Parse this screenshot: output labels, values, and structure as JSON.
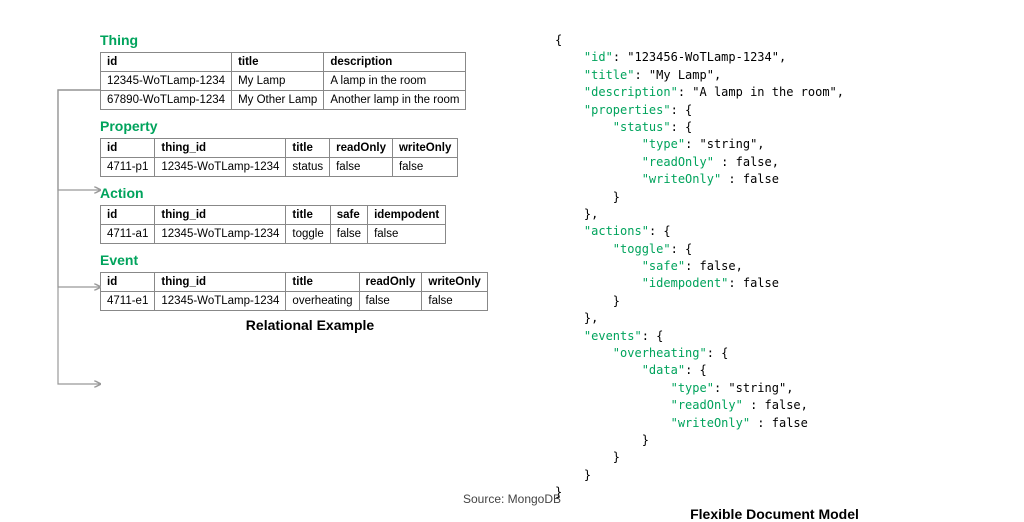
{
  "left": {
    "thing": {
      "title": "Thing",
      "headers": [
        "id",
        "title",
        "description"
      ],
      "rows": [
        [
          "12345-WoTLamp-1234",
          "My Lamp",
          "A lamp in the room"
        ],
        [
          "67890-WoTLamp-1234",
          "My Other Lamp",
          "Another lamp in the room"
        ]
      ]
    },
    "property": {
      "title": "Property",
      "headers": [
        "id",
        "thing_id",
        "title",
        "readOnly",
        "writeOnly"
      ],
      "rows": [
        [
          "4711-p1",
          "12345-WoTLamp-1234",
          "status",
          "false",
          "false"
        ]
      ]
    },
    "action": {
      "title": "Action",
      "headers": [
        "id",
        "thing_id",
        "title",
        "safe",
        "idempodent"
      ],
      "rows": [
        [
          "4711-a1",
          "12345-WoTLamp-1234",
          "toggle",
          "false",
          "false"
        ]
      ]
    },
    "event": {
      "title": "Event",
      "headers": [
        "id",
        "thing_id",
        "title",
        "readOnly",
        "writeOnly"
      ],
      "rows": [
        [
          "4711-e1",
          "12345-WoTLamp-1234",
          "overheating",
          "false",
          "false"
        ]
      ]
    },
    "caption": "Relational Example"
  },
  "right": {
    "json": {
      "id": "123456-WoTLamp-1234",
      "title": "My Lamp",
      "description": "A lamp in the room",
      "properties": {
        "status": {
          "type": "string",
          "readOnly": false,
          "writeOnly": false
        }
      },
      "actions": {
        "toggle": {
          "safe": false,
          "idempodent": false
        }
      },
      "events": {
        "overheating": {
          "data": {
            "type": "string",
            "readOnly": false,
            "writeOnly": false
          }
        }
      }
    },
    "caption": "Flexible Document Model"
  },
  "source": "Source: MongoDB"
}
